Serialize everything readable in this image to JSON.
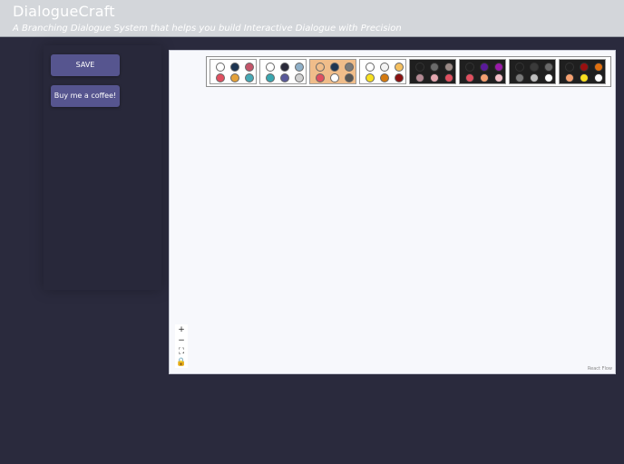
{
  "header": {
    "title": "DialogueCraft",
    "subtitle": "A Branching Dialogue System that helps you build Interactive Dialogue with Precision"
  },
  "sidebar": {
    "save_label": "SAVE",
    "coffee_label": "Buy me a coffee!"
  },
  "canvas": {
    "controls": {
      "zoom_in": "+",
      "zoom_out": "−",
      "fit_view": "⛶",
      "lock": "🔒"
    },
    "attribution": "React Flow"
  },
  "themes": [
    {
      "bg": "#ffffff",
      "colors": [
        "#ffffff",
        "#1e3552",
        "#c4556a",
        "#e05060",
        "#e5a23a",
        "#47a9b5"
      ]
    },
    {
      "bg": "#ffffff",
      "colors": [
        "#ffffff",
        "#2a2a3a",
        "#8fb0c8",
        "#3aa7b0",
        "#5a5a9a",
        "#d0d0d0"
      ]
    },
    {
      "bg": "#f0bd8a",
      "colors": [
        "#f0bd8a",
        "#1e3552",
        "#7a7a7a",
        "#e05060",
        "#ffffff",
        "#555555"
      ]
    },
    {
      "bg": "#ffffff",
      "colors": [
        "#ffffff",
        "#f4f4f4",
        "#f5c060",
        "#f8e020",
        "#d47a10",
        "#8a1010"
      ]
    },
    {
      "bg": "#1f1f1f",
      "colors": [
        "#1f1f1f",
        "#6a6a6a",
        "#9a8a86",
        "#b48a94",
        "#e4a7b0",
        "#e05060"
      ]
    },
    {
      "bg": "#1f1f1f",
      "colors": [
        "#1f1f1f",
        "#5a1a9a",
        "#9a1aa8",
        "#e05060",
        "#f5a070",
        "#f5c0c8"
      ]
    },
    {
      "bg": "#1f1f1f",
      "colors": [
        "#1f1f1f",
        "#3a3a3a",
        "#6a6a6a",
        "#7a7a7a",
        "#bfbfbf",
        "#ffffff"
      ]
    },
    {
      "bg": "#1f1f1f",
      "colors": [
        "#1f1f1f",
        "#9a1010",
        "#e07010",
        "#f5a070",
        "#f8e020",
        "#ffffff"
      ]
    }
  ]
}
